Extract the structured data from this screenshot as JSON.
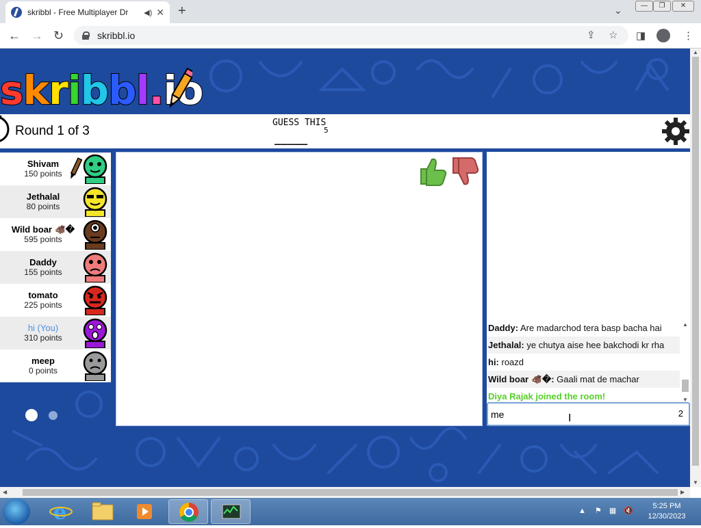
{
  "browser": {
    "tab_title": "skribbl - Free Multiplayer Dr",
    "url": "skribbl.io",
    "window_controls": [
      "minimize",
      "restore",
      "close"
    ]
  },
  "logo": {
    "letters": [
      "s",
      "k",
      "r",
      "i",
      "b",
      "b",
      "l",
      ".",
      "i",
      "o"
    ],
    "colors": [
      "#ff3b30",
      "#ff8a00",
      "#ffe000",
      "#38d430",
      "#21c6e8",
      "#2a5bff",
      "#a23bff",
      "#ff4fa8",
      "#ffffff",
      "#ffffff"
    ]
  },
  "header": {
    "round": "Round 1 of 3",
    "guess_label": "GUESS THIS",
    "word_length": "5",
    "blanks": "_____"
  },
  "players": [
    {
      "name": "Shivam",
      "points": "150 points",
      "face": "#2fce82",
      "drawing": true
    },
    {
      "name": "Jethalal",
      "points": "80 points",
      "face": "#f4e52b",
      "drawing": false
    },
    {
      "name": "Wild boar 🐗�",
      "points": "595 points",
      "face": "#6a3b1e",
      "drawing": false
    },
    {
      "name": "Daddy",
      "points": "155 points",
      "face": "#f07b7b",
      "drawing": false
    },
    {
      "name": "tomato",
      "points": "225 points",
      "face": "#d9271d",
      "drawing": false
    },
    {
      "name": "hi (You)",
      "points": "310 points",
      "face": "#9b17d6",
      "drawing": false
    },
    {
      "name": "meep",
      "points": "0 points",
      "face": "#9a9a9a",
      "drawing": false
    }
  ],
  "chat": {
    "messages": [
      {
        "author": "Daddy:",
        "text": " Are madarchod tera basp bacha hai",
        "type": "normal"
      },
      {
        "author": "Jethalal:",
        "text": " ye chutya aise hee bakchodi kr rha",
        "type": "normal"
      },
      {
        "author": "hi:",
        "text": " roazd",
        "type": "normal"
      },
      {
        "author": "Wild boar 🐗�:",
        "text": " Gaali mat de machar",
        "type": "normal"
      },
      {
        "author": "",
        "text": "Diya Rajak joined the room!",
        "type": "join"
      }
    ],
    "input_value": "me",
    "char_count": "2"
  },
  "taskbar": {
    "time": "5:25 PM",
    "date": "12/30/2023",
    "apps": [
      "start-orb",
      "internet-explorer",
      "file-explorer",
      "media-player",
      "chrome",
      "task-manager"
    ]
  },
  "colors": {
    "page_bg": "#1e4a9e",
    "join_green": "#56ce27",
    "you_blue": "#4a90e2"
  }
}
